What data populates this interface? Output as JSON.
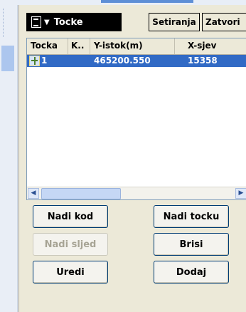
{
  "window": {
    "title": "Tocke"
  },
  "toolbar": {
    "setiranja_label": "Setiranja",
    "zatvori_label": "Zatvori"
  },
  "table": {
    "columns": [
      "Tocka",
      "K..",
      "Y-istok(m)",
      "X-sjev"
    ],
    "rows": [
      {
        "tocka": "1",
        "kod": "",
        "y_istok": "465200.550",
        "x_sjever": "15358"
      }
    ],
    "selected_row": 0
  },
  "buttons": {
    "nadi_kod": "Nadi kod",
    "nadi_tocku": "Nadi tocku",
    "nadi_sljed": "Nadi sljed",
    "brisi": "Brisi",
    "uredi": "Uredi",
    "dodaj": "Dodaj"
  },
  "icons": {
    "menu": "menu-icon",
    "row": "point-icon",
    "scroll_left": "arrow-left-icon",
    "scroll_right": "arrow-right-icon"
  },
  "colors": {
    "selection": "#316ac5",
    "panel": "#ece9d8",
    "disabled_text": "#a7a495"
  }
}
